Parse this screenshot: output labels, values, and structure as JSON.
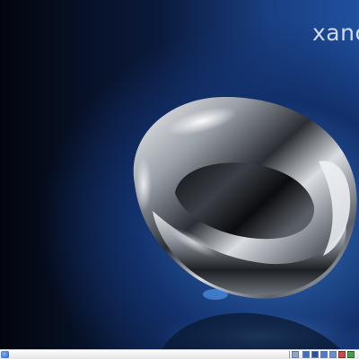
{
  "desktop": {
    "brand_text": "xanc",
    "wallpaper": "chrome-torus-wallpaper"
  },
  "taskbar": {
    "start_icon": "start-menu-icon",
    "tray_icons": [
      "tray-app-icon",
      "tray-window-icon",
      "tray-display-icon",
      "tray-network-icon",
      "tray-volume-icon",
      "tray-alert-icon",
      "tray-update-icon"
    ]
  },
  "colors": {
    "background_dark": "#03060e",
    "background_blue": "#2f66b4",
    "taskbar": "#f2f2f2"
  }
}
